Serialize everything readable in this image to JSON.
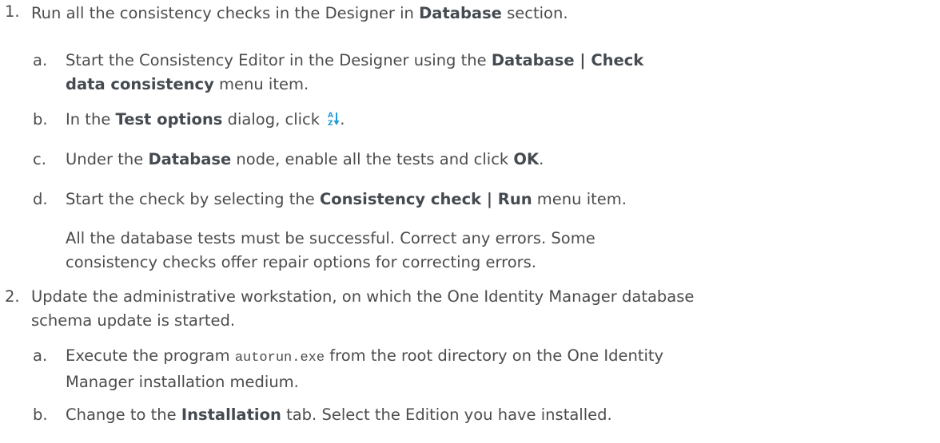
{
  "steps": [
    {
      "marker": "1.",
      "lines": [
        {
          "text": "Run all the consistency checks in the Designer in ",
          "bold": "Database",
          "after": " section."
        }
      ],
      "substeps": [
        {
          "marker": "a.",
          "line1_pre": "Start the Consistency Editor in the Designer using the ",
          "line1_bold": "Database | Check",
          "line2_bold": "data consistency",
          "line2_post": " menu item."
        },
        {
          "marker": "b.",
          "pre": "In the ",
          "bold": "Test options",
          "post": " dialog, click ",
          "icon": "sort-az-icon",
          "end": "."
        },
        {
          "marker": "c.",
          "pre": "Under the ",
          "bold": "Database",
          "mid": " node, enable all the tests and click ",
          "bold2": "OK",
          "end": "."
        },
        {
          "marker": "d.",
          "pre": "Start the check by selecting the ",
          "bold": "Consistency check | Run",
          "post": " menu item.",
          "note_line1": "All the database tests must be successful. Correct any errors. Some",
          "note_line2": "consistency checks offer repair options for correcting errors."
        }
      ]
    },
    {
      "marker": "2.",
      "line1": "Update the administrative workstation, on which the One Identity Manager database",
      "line2": "schema update is started.",
      "substeps": [
        {
          "marker": "a.",
          "pre": "Execute the program ",
          "code": "autorun.exe",
          "post": " from the root directory on the One Identity",
          "line2": "Manager installation medium."
        },
        {
          "marker": "b.",
          "pre": "Change to the ",
          "bold": "Installation",
          "post": " tab. Select the Edition you have installed."
        }
      ]
    }
  ],
  "colors": {
    "text": "#4c4c4c",
    "icon_blue": "#1e9bd7"
  }
}
